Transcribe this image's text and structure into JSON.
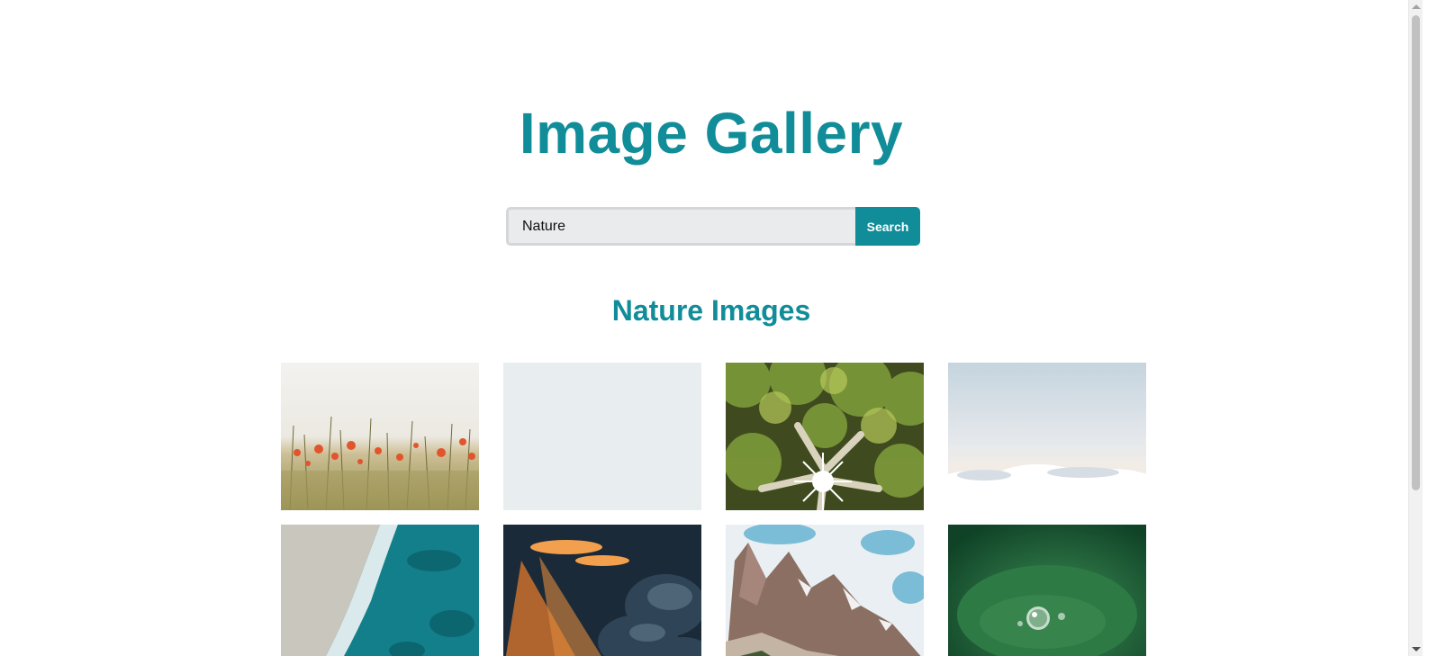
{
  "header": {
    "title": "Image Gallery"
  },
  "search": {
    "value": "Nature",
    "button_label": "Search"
  },
  "results": {
    "heading": "Nature Images",
    "images": [
      {
        "subject": "poppy-field"
      },
      {
        "subject": "pale-sky"
      },
      {
        "subject": "tree-canopy-sunburst"
      },
      {
        "subject": "sea-of-clouds"
      },
      {
        "subject": "aerial-beach"
      },
      {
        "subject": "sunbeams-through-clouds"
      },
      {
        "subject": "rocky-mountain-peak"
      },
      {
        "subject": "water-drop-on-leaf"
      }
    ]
  },
  "colors": {
    "accent": "#118c99",
    "input_bg": "#e9ebed",
    "page_bg": "#ffffff"
  }
}
